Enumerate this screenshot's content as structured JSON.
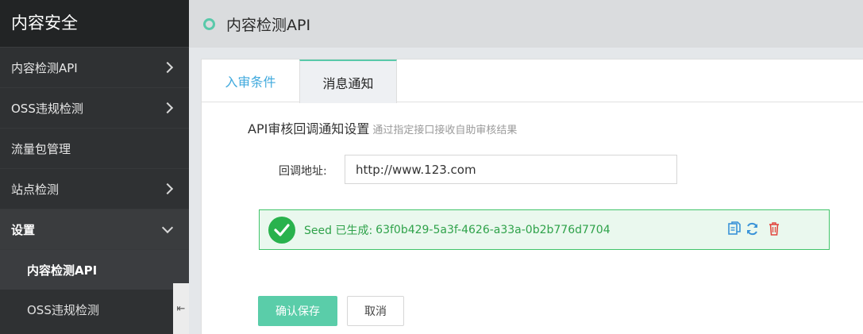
{
  "sidebar": {
    "title": "内容安全",
    "items": [
      {
        "label": "内容检测API"
      },
      {
        "label": "OSS违规检测"
      },
      {
        "label": "流量包管理"
      },
      {
        "label": "站点检测"
      },
      {
        "label": "设置"
      }
    ],
    "sub_items": [
      {
        "label": "内容检测API"
      },
      {
        "label": "OSS违规检测"
      }
    ],
    "collapse_glyph": "⇤"
  },
  "header": {
    "title": "内容检测API"
  },
  "tabs": [
    {
      "label": "入审条件"
    },
    {
      "label": "消息通知"
    }
  ],
  "section": {
    "title": "API审核回调通知设置",
    "hint": "通过指定接口接收自助审核结果"
  },
  "callback": {
    "label": "回调地址:",
    "value": "http://www.123.com"
  },
  "seed": {
    "label": "Seed 已生成:",
    "value": "63f0b429-5a3f-4626-a33a-0b2b776d7704"
  },
  "buttons": {
    "save": "确认保存",
    "cancel": "取消"
  },
  "icons": {
    "copy": "copy-icon",
    "refresh": "refresh-icon",
    "delete": "trash-icon",
    "success": "check-circle-icon"
  },
  "colors": {
    "accent": "#59c9aa",
    "success": "#29b24d",
    "link": "#3fa9dd",
    "danger": "#e2463e"
  }
}
